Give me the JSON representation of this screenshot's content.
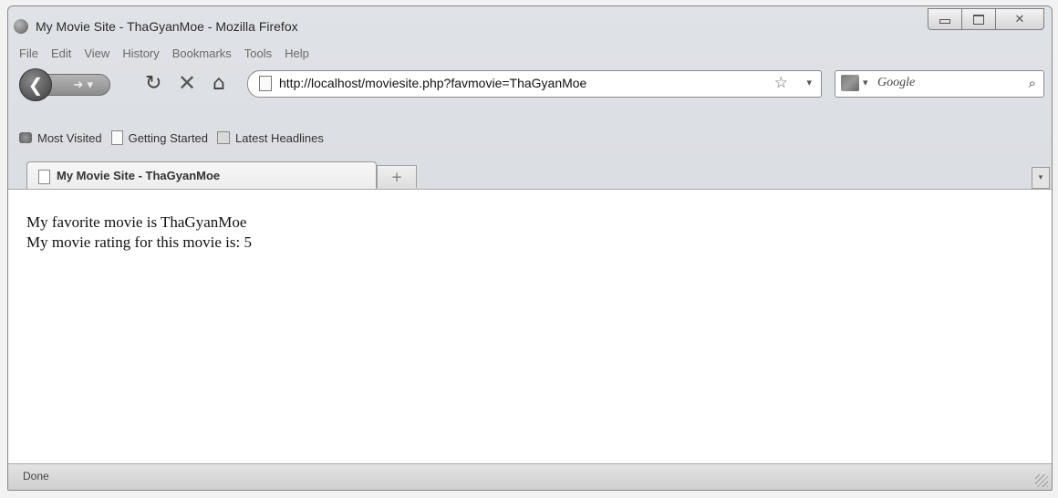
{
  "window": {
    "title": "My Movie Site - ThaGyanMoe - Mozilla Firefox"
  },
  "menu": [
    "File",
    "Edit",
    "View",
    "History",
    "Bookmarks",
    "Tools",
    "Help"
  ],
  "nav": {
    "url": "http://localhost/moviesite.php?favmovie=ThaGyanMoe",
    "search_placeholder": "Google"
  },
  "bookmarks": [
    "Most Visited",
    "Getting Started",
    "Latest Headlines"
  ],
  "tabs": [
    {
      "label": "My Movie Site - ThaGyanMoe",
      "active": true
    }
  ],
  "page": {
    "line1": "My favorite movie is ThaGyanMoe",
    "line2": "My movie rating for this movie is: 5"
  },
  "status": {
    "text": "Done"
  },
  "icons": {
    "app": "firefox-icon",
    "back": "back-arrow-icon",
    "forward": "forward-arrow-icon",
    "reload": "reload-icon",
    "stop": "stop-icon",
    "home": "home-icon",
    "star": "bookmark-star-icon",
    "search": "magnifier-icon"
  }
}
